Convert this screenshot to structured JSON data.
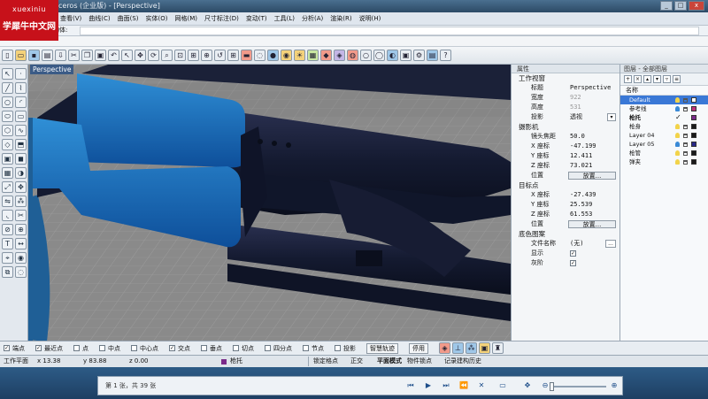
{
  "titlebar": {
    "title": "ceros (企业版) - [Perspective]"
  },
  "watermark": {
    "site": "xuexiniu",
    "name": "学犀牛中文网"
  },
  "menu": [
    "查看(V)",
    "曲线(C)",
    "曲面(S)",
    "实体(O)",
    "网格(M)",
    "尺寸标注(D)",
    "变动(T)",
    "工具(L)",
    "分析(A)",
    "渲染(R)",
    "说明(H)"
  ],
  "command": {
    "prompt": "物体:"
  },
  "viewport": {
    "label": "Perspective"
  },
  "properties": {
    "header": "属性",
    "viewport_section": "工作视窗",
    "title_label": "标题",
    "title_value": "Perspective",
    "width_label": "宽度",
    "width_value": "922",
    "height_label": "高度",
    "height_value": "531",
    "projection_label": "投影",
    "projection_value": "透视",
    "camera_section": "摄影机",
    "lens_label": "镜头焦距",
    "lens_value": "50.0",
    "cx_label": "X 座标",
    "cx_value": "-47.199",
    "cy_label": "Y 座标",
    "cy_value": "12.411",
    "cz_label": "Z 座标",
    "cz_value": "73.021",
    "pos_label": "位置",
    "place_button": "放置...",
    "target_section": "目标点",
    "tx_label": "X 座标",
    "tx_value": "-27.439",
    "ty_label": "Y 座标",
    "ty_value": "25.539",
    "tz_label": "Z 座标",
    "tz_value": "61.553",
    "tpos_label": "位置",
    "tplace_button": "放置...",
    "bg_section": "底色图案",
    "file_label": "文件名称",
    "file_value": "(无)",
    "browse": "...",
    "show_label": "显示",
    "gray_label": "灰阶"
  },
  "layers": {
    "header": "图层 - 全部图层",
    "name_col": "名称",
    "rows": [
      {
        "name": "Default",
        "color": "#ffffff"
      },
      {
        "name": "参考线",
        "color": "#c0307a"
      },
      {
        "name": "枪托",
        "color": "#7a2a8a"
      },
      {
        "name": "枪身",
        "color": "#1a1a1a"
      },
      {
        "name": "Layer 04",
        "color": "#1a1a1a"
      },
      {
        "name": "Layer 05",
        "color": "#2a2a8a"
      },
      {
        "name": "枪管",
        "color": "#1a1a1a"
      },
      {
        "name": "弹夹",
        "color": "#1a1a1a"
      }
    ]
  },
  "osnap": [
    "端点",
    "最近点",
    "点",
    "中点",
    "中心点",
    "交点",
    "垂点",
    "切点",
    "四分点",
    "节点",
    "投影",
    "智慧轨迹",
    "停用"
  ],
  "status": {
    "plane": "工作平面",
    "x": "x 13.38",
    "y": "y 83.88",
    "z": "z 0.00",
    "layer": "枪托",
    "lock_grid": "锁定格点",
    "ortho": "正交",
    "planar": "平面模式",
    "osnap_mode": "物件锁点",
    "history": "记录建构历史"
  },
  "pager": {
    "text": "第 1 张，共 39 张"
  }
}
